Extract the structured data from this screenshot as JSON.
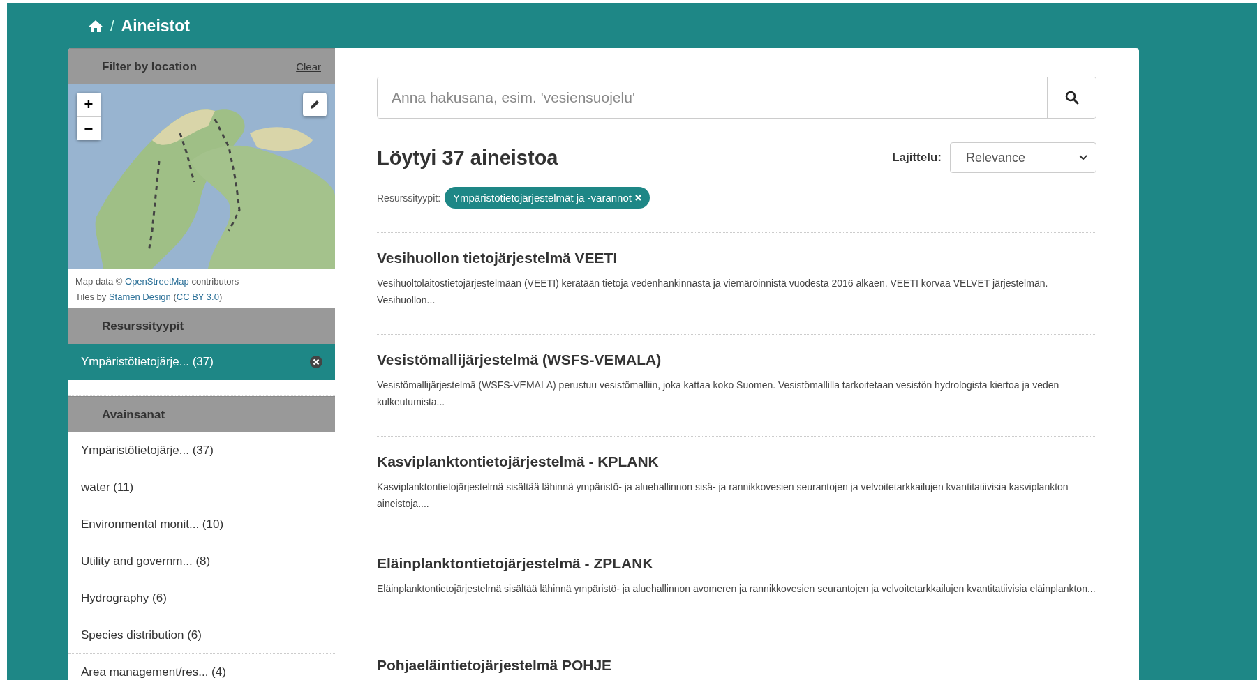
{
  "breadcrumb": {
    "separator": "/",
    "current": "Aineistot"
  },
  "location_filter": {
    "title": "Filter by location",
    "clear": "Clear",
    "zoom_in": "+",
    "zoom_out": "−",
    "attribution": [
      {
        "parts": [
          {
            "kind": "text",
            "text": "Map data © "
          },
          {
            "kind": "link",
            "text": "OpenStreetMap"
          },
          {
            "kind": "text",
            "text": " contributors"
          }
        ]
      },
      {
        "parts": [
          {
            "kind": "text",
            "text": "Tiles by "
          },
          {
            "kind": "link",
            "text": "Stamen Design"
          },
          {
            "kind": "text",
            "text": " ("
          },
          {
            "kind": "link",
            "text": "CC BY 3.0"
          },
          {
            "kind": "text",
            "text": ")"
          }
        ]
      }
    ]
  },
  "facets": [
    {
      "title": "Resurssityypit",
      "items": [
        {
          "label": "Ympäristötietojärje... (37)",
          "selected": true
        }
      ]
    },
    {
      "title": "Avainsanat",
      "items": [
        {
          "label": "Ympäristötietojärje... (37)",
          "selected": false
        },
        {
          "label": "water (11)",
          "selected": false
        },
        {
          "label": "Environmental monit... (10)",
          "selected": false
        },
        {
          "label": "Utility and governm... (8)",
          "selected": false
        },
        {
          "label": "Hydrography (6)",
          "selected": false
        },
        {
          "label": "Species distribution (6)",
          "selected": false
        },
        {
          "label": "Area management/res... (4)",
          "selected": false
        }
      ]
    }
  ],
  "search": {
    "placeholder": "Anna hakusana, esim. 'vesiensuojelu'"
  },
  "results_heading": "Löytyi 37 aineistoa",
  "sort": {
    "label": "Lajittelu:",
    "value": "Relevance"
  },
  "active_filter": {
    "label": "Resurssityypit:",
    "tag": "Ympäristötietojärjestelmät ja -varannot"
  },
  "results": [
    {
      "title": "Vesihuollon tietojärjestelmä VEETI",
      "description": "Vesihuoltolaitostietojärjestelmään (VEETI) kerätään tietoja vedenhankinnasta ja viemäröinnistä vuodesta 2016 alkaen. VEETI korvaa VELVET järjestelmän. Vesihuollon..."
    },
    {
      "title": "Vesistömallijärjestelmä (WSFS-VEMALA)",
      "description": "Vesistömallijärjestelmä (WSFS-VEMALA) perustuu vesistömalliin, joka kattaa koko Suomen. Vesistömallilla tarkoitetaan vesistön hydrologista kiertoa ja veden kulkeutumista..."
    },
    {
      "title": "Kasviplanktontietojärjestelmä - KPLANK",
      "description": "Kasviplanktontietojärjestelmä sisältää lähinnä ympäristö- ja aluehallinnon sisä- ja rannikkovesien seurantojen ja velvoitetarkkailujen kvantitatiivisia kasviplankton aineistoja...."
    },
    {
      "title": "Eläinplanktontietojärjestelmä - ZPLANK",
      "description": "Eläinplanktontietojärjestelmä sisältää lähinnä ympäristö- ja aluehallinnon avomeren ja rannikkovesien seurantojen ja velvoitetarkkailujen kvantitatiivisia eläinplankton..."
    },
    {
      "title": "Pohjaeläintietojärjestelmä POHJE"
    }
  ]
}
